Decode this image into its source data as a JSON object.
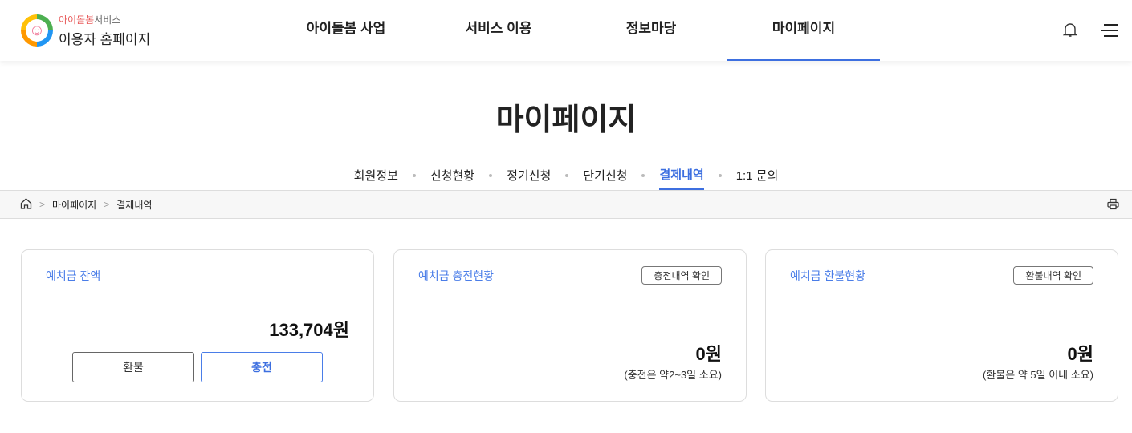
{
  "header": {
    "logo_sub_highlight": "아이돌봄",
    "logo_sub": "서비스",
    "logo_main": "이용자 홈페이지",
    "nav": [
      "아이돌봄 사업",
      "서비스 이용",
      "정보마당",
      "마이페이지"
    ],
    "active_nav": 3
  },
  "page_title": "마이페이지",
  "tabs": [
    "회원정보",
    "신청현황",
    "정기신청",
    "단기신청",
    "결제내역",
    "1:1 문의"
  ],
  "breadcrumb": [
    "마이페이지",
    "결제내역"
  ],
  "cards": {
    "balance": {
      "title": "예치금 잔액",
      "amount": "133,704원",
      "refund_label": "환불",
      "charge_label": "충전"
    },
    "charge": {
      "title": "예치금 충전현황",
      "button": "충전내역 확인",
      "amount": "0원",
      "note": "(충전은 약2~3일 소요)"
    },
    "refund": {
      "title": "예치금 환불현황",
      "button": "환불내역 확인",
      "amount": "0원",
      "note": "(환불은 약 5일 이내 소요)"
    }
  },
  "colors": {
    "accent": "#3d6fe0"
  }
}
